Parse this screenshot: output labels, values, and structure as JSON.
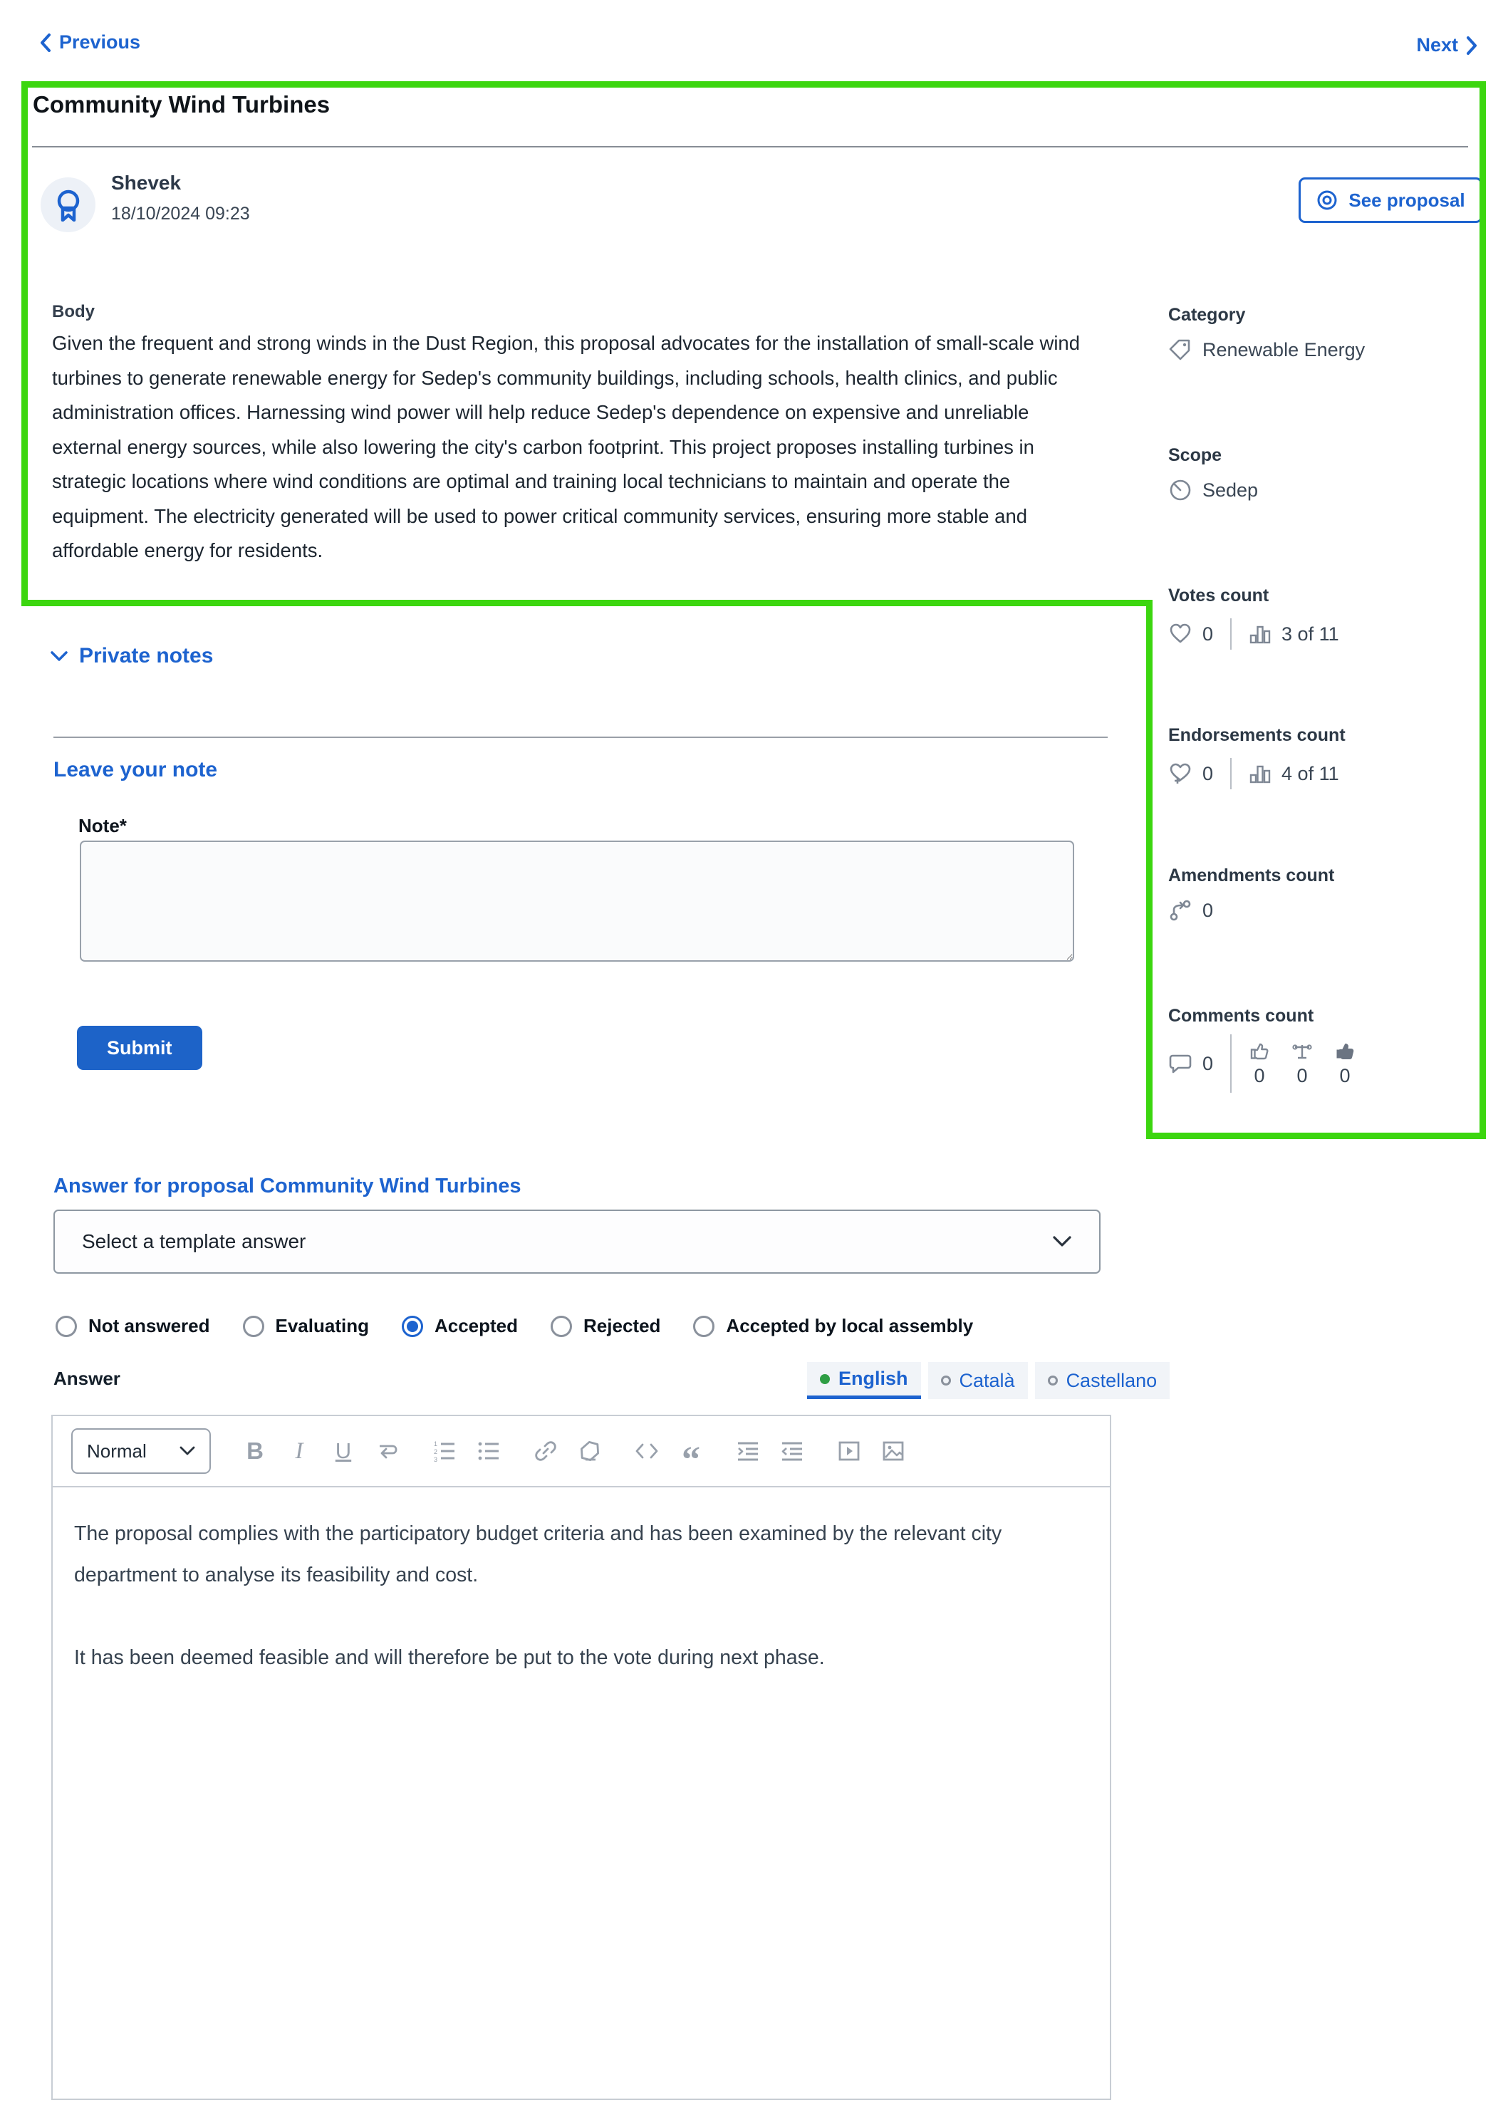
{
  "nav": {
    "previous": "Previous",
    "next": "Next"
  },
  "proposal": {
    "title": "Community Wind Turbines",
    "author": "Shevek",
    "date": "18/10/2024 09:23",
    "see_proposal": "See proposal",
    "body_label": "Body",
    "body": "Given the frequent and strong winds in the Dust Region, this proposal advocates for the installation of small-scale wind turbines to generate renewable energy for Sedep's community buildings, including schools, health clinics, and public administration offices. Harnessing wind power will help reduce Sedep's dependence on expensive and unreliable external energy sources, while also lowering the city's carbon footprint. This project proposes installing turbines in strategic locations where wind conditions are optimal and training local technicians to maintain and operate the equipment. The electricity generated will be used to power critical community services, ensuring more stable and affordable energy for residents."
  },
  "sidebar": {
    "category_label": "Category",
    "category": "Renewable Energy",
    "scope_label": "Scope",
    "scope": "Sedep",
    "votes_label": "Votes count",
    "votes_count": "0",
    "votes_ranking": "3 of 11",
    "endorsements_label": "Endorsements count",
    "endorsements_count": "0",
    "endorsements_ranking": "4 of 11",
    "amendments_label": "Amendments count",
    "amendments_count": "0",
    "comments_label": "Comments count",
    "comments_count": "0",
    "comments_up": "0",
    "comments_neutral": "0",
    "comments_down": "0"
  },
  "notes": {
    "section_title": "Private notes",
    "heading": "Leave your note",
    "note_label": "Note*",
    "submit": "Submit"
  },
  "answer": {
    "heading": "Answer for proposal Community Wind Turbines",
    "template_placeholder": "Select a template answer",
    "statuses": [
      "Not answered",
      "Evaluating",
      "Accepted",
      "Rejected",
      "Accepted by local assembly"
    ],
    "selected_status": "Accepted",
    "answer_label": "Answer",
    "languages": [
      "English",
      "Català",
      "Castellano"
    ],
    "selected_language": "English",
    "toolbar": {
      "format": "Normal",
      "bold": "B",
      "italic": "I",
      "underline": "U",
      "quote": "“"
    },
    "editor_paragraphs": [
      "The proposal complies with the participatory budget criteria and has been examined by the relevant city department to analyse its feasibility and cost.",
      "It has been deemed feasible and will therefore be put to the vote during next phase."
    ]
  },
  "colors": {
    "accent_blue": "#1d63cf",
    "submit_blue": "#1d63c8",
    "annotation_green": "#3cd60f",
    "active_language_dot_green": "#2e9e44"
  }
}
